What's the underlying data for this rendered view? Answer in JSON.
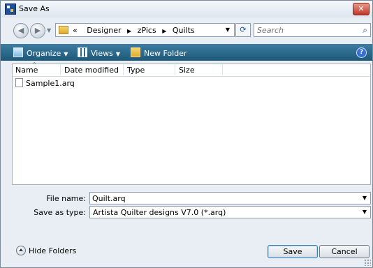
{
  "window": {
    "title": "Save As",
    "close_label": "✕"
  },
  "address": {
    "back_label": "◀",
    "forward_label": "▶",
    "path_prefix": "«",
    "path": [
      "Designer",
      "zPics",
      "Quilts"
    ],
    "separator": "▶",
    "search_placeholder": "Search"
  },
  "toolbar": {
    "organize_label": "Organize",
    "views_label": "Views",
    "new_folder_label": "New Folder",
    "help_label": "?"
  },
  "list": {
    "columns": [
      "Name",
      "Date modified",
      "Type",
      "Size"
    ],
    "files": [
      {
        "name": "Sample1.arq"
      }
    ]
  },
  "form": {
    "file_name_label": "File name:",
    "file_name_value": "Quilt.arq",
    "save_type_label": "Save as type:",
    "save_type_value": "Artista Quilter designs V7.0 (*.arq)"
  },
  "footer": {
    "hide_folders_label": "Hide Folders",
    "save_label": "Save",
    "cancel_label": "Cancel"
  },
  "colors": {
    "toolbar": "#2b6a8d",
    "close_button": "#c0392b",
    "window_bg": "#e8eef4"
  }
}
